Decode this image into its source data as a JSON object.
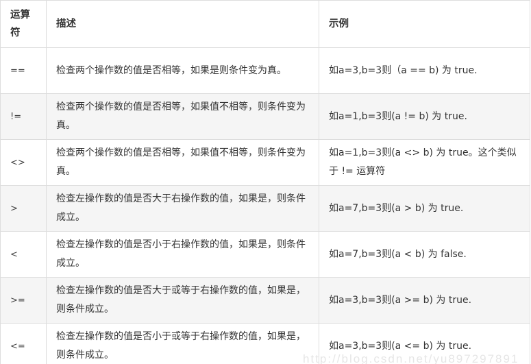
{
  "table": {
    "headers": {
      "operator": "运算符",
      "description": "描述",
      "example": "示例"
    },
    "rows": [
      {
        "operator": "==",
        "description": "检查两个操作数的值是否相等，如果是则条件变为真。",
        "example": "如a=3,b=3则（a == b) 为 true."
      },
      {
        "operator": "!=",
        "description": "检查两个操作数的值是否相等，如果值不相等，则条件变为真。",
        "example": "如a=1,b=3则(a != b) 为 true."
      },
      {
        "operator": "<>",
        "description": "检查两个操作数的值是否相等，如果值不相等，则条件变为真。",
        "example": "如a=1,b=3则(a <> b) 为 true。这个类似于 != 运算符"
      },
      {
        "operator": ">",
        "description": "检查左操作数的值是否大于右操作数的值，如果是，则条件成立。",
        "example": "如a=7,b=3则(a > b) 为 true."
      },
      {
        "operator": "<",
        "description": "检查左操作数的值是否小于右操作数的值，如果是，则条件成立。",
        "example": "如a=7,b=3则(a < b) 为 false."
      },
      {
        "operator": ">=",
        "description": "检查左操作数的值是否大于或等于右操作数的值，如果是，则条件成立。",
        "example": "如a=3,b=3则(a >= b) 为 true."
      },
      {
        "operator": "<=",
        "description": "检查左操作数的值是否小于或等于右操作数的值，如果是，则条件成立。",
        "example": "如a=3,b=3则(a <= b) 为 true."
      }
    ]
  },
  "watermark": "http://blog.csdn.net/yu897297891"
}
